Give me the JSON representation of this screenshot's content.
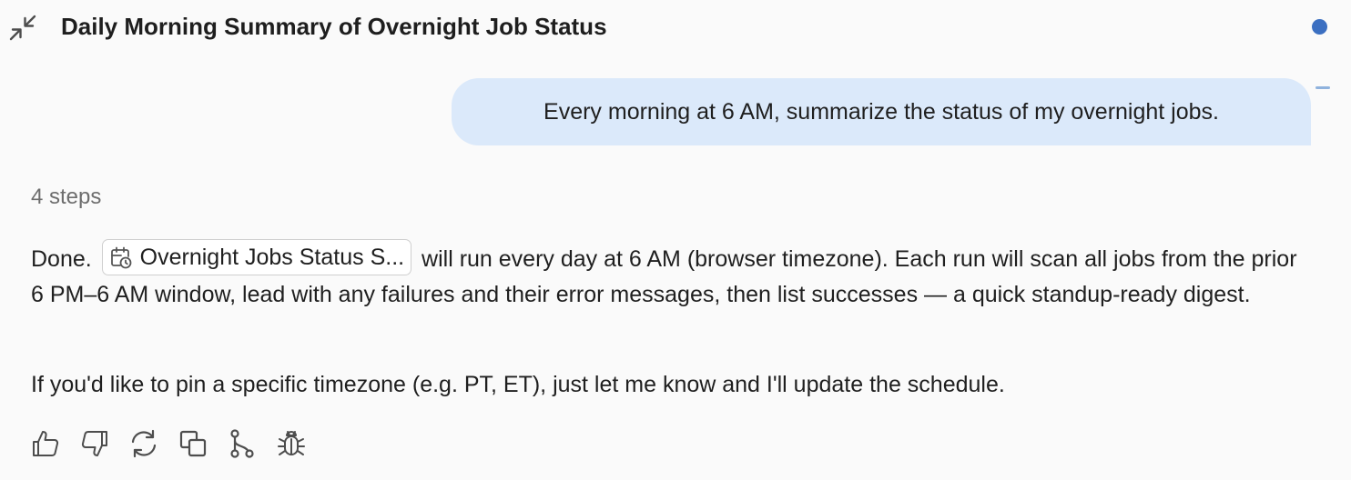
{
  "header": {
    "title": "Daily Morning Summary of Overnight Job Status",
    "collapse_icon": "collapse-arrows-icon",
    "status_dot_color": "#3b6fc1"
  },
  "colors": {
    "background": "#fafafa",
    "user_bubble": "#dbe9fa",
    "scroll_marker": "#8fb2dd",
    "icon_gray": "#4d4d4d"
  },
  "conversation": {
    "user_message": "Every morning at 6 AM, summarize the status of my overnight jobs.",
    "steps_label": "4 steps",
    "response": {
      "p1_lead": "Done.",
      "chip_icon": "calendar-clock-icon",
      "chip_label": "Overnight Jobs Status S...",
      "p1_rest": " will run every day at 6 AM (browser timezone). Each run will scan all jobs from the prior 6 PM–6 AM window, lead with any failures and their error messages, then list successes — a quick standup-ready digest.",
      "p2": "If you'd like to pin a specific timezone (e.g. PT, ET), just let me know and I'll update the schedule."
    }
  },
  "actions": [
    {
      "name": "thumbs-up-icon"
    },
    {
      "name": "thumbs-down-icon"
    },
    {
      "name": "regenerate-icon"
    },
    {
      "name": "copy-icon"
    },
    {
      "name": "branch-icon"
    },
    {
      "name": "bug-icon"
    }
  ]
}
